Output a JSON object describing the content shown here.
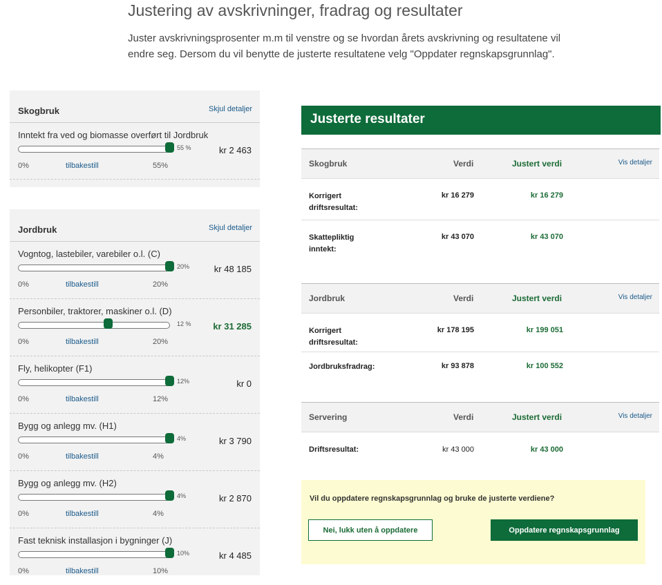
{
  "page": {
    "title": "Justering av avskrivninger, fradrag og resultater",
    "intro": "Juster avskrivningsprosenter m.m til venstre og se hvordan årets avskrivning og resultatene vil endre seg. Dersom du vil benytte de justerte resultatene velg \"Oppdater regnskapsgrunnlag\"."
  },
  "skogbruk_panel": {
    "title": "Skogbruk",
    "toggle_label": "Skjul detaljer",
    "rows": [
      {
        "label": "Inntekt fra ved og biomasse overført til Jordbruk",
        "value_label": "55 %",
        "amount": "kr 2 463",
        "min": "0%",
        "reset": "tilbakestill",
        "max": "55%",
        "level": 1.0
      }
    ]
  },
  "jordbruk_panel": {
    "title": "Jordbruk",
    "toggle_label": "Skjul detaljer",
    "rows": [
      {
        "label": "Vogntog, lastebiler, varebiler o.l. (C)",
        "value_label": "20%",
        "amount": "kr 48 185",
        "min": "0%",
        "reset": "tilbakestill",
        "max": "20%",
        "level": 1.0
      },
      {
        "label": "Personbiler, traktorer, maskiner o.l. (D)",
        "value_label": "12 %",
        "amount": "kr 31 285",
        "min": "0%",
        "reset": "tilbakestill",
        "max": "20%",
        "level": 0.6
      },
      {
        "label": "Fly, helikopter (F1)",
        "value_label": "12%",
        "amount": "kr 0",
        "min": "0%",
        "reset": "tilbakestill",
        "max": "12%",
        "level": 1.0
      },
      {
        "label": "Bygg og anlegg mv. (H1)",
        "value_label": "4%",
        "amount": "kr 3 790",
        "min": "0%",
        "reset": "tilbakestill",
        "max": "4%",
        "level": 1.0
      },
      {
        "label": "Bygg og anlegg mv. (H2)",
        "value_label": "4%",
        "amount": "kr 2 870",
        "min": "0%",
        "reset": "tilbakestill",
        "max": "4%",
        "level": 1.0
      },
      {
        "label": "Fast teknisk installasjon i bygninger (J)",
        "value_label": "10%",
        "amount": "kr 4 485",
        "min": "0%",
        "reset": "tilbakestill",
        "max": "10%",
        "level": 1.0
      }
    ]
  },
  "results": {
    "title": "Justerte resultater",
    "sections": [
      {
        "name": "Skogbruk",
        "col_value": "Verdi",
        "col_adjusted": "Justert verdi",
        "link": "Vis detaljer",
        "rows": [
          {
            "label": "Korrigert driftsresultat:",
            "value": "kr 16 279",
            "adjusted": "kr 16 279"
          },
          {
            "label": "Skattepliktig inntekt:",
            "value": "kr 43 070",
            "adjusted": "kr 43 070"
          }
        ]
      },
      {
        "name": "Jordbruk",
        "col_value": "Verdi",
        "col_adjusted": "Justert verdi",
        "link": "Vis detaljer",
        "rows": [
          {
            "label": "Korrigert driftsresultat:",
            "value": "kr 178 195",
            "adjusted": "kr 199 051"
          },
          {
            "label": "Jordbruksfradrag:",
            "value": "kr 93 878",
            "adjusted": "kr 100 552"
          }
        ]
      },
      {
        "name": "Servering",
        "col_value": "Verdi",
        "col_adjusted": "Justert verdi",
        "link": "Vis detaljer",
        "rows": [
          {
            "label": "Driftsresultat:",
            "value": "kr 43 000",
            "adjusted": "kr 43 000"
          }
        ]
      }
    ]
  },
  "update": {
    "question": "Vil du oppdatere regnskapsgrunnlag og bruke de justerte verdiene?",
    "cancel_label": "Nei, lukk uten å oppdatere",
    "confirm_label": "Oppdatere regnskapsgrunnlag"
  },
  "colors": {
    "accent": "#0e6b3a",
    "link": "#1a5a8a",
    "panel_bg": "#f2f2f2",
    "update_bg": "#fdfbd1"
  }
}
